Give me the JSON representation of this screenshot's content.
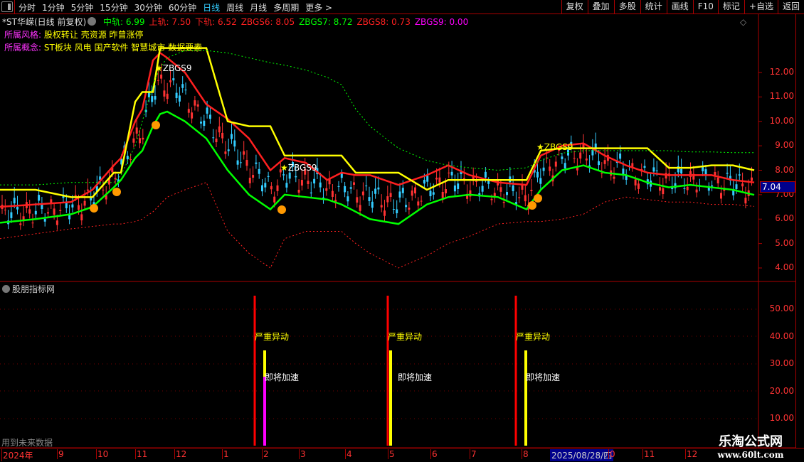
{
  "toolbar": {
    "periods": [
      "分时",
      "1分钟",
      "5分钟",
      "15分钟",
      "30分钟",
      "60分钟",
      "日线",
      "周线",
      "月线",
      "多周期",
      "更多 >"
    ],
    "active": "日线",
    "right_buttons": [
      "复权",
      "叠加",
      "多股",
      "统计",
      "画线",
      "F10",
      "标记",
      "+自选",
      "返回"
    ]
  },
  "stock": {
    "title": "*ST华嵘(日线 前复权)",
    "indicators": [
      {
        "label": "中轨:",
        "value": "6.99",
        "color": "#00ff00"
      },
      {
        "label": "上轨:",
        "value": "7.50",
        "color": "#ff2020"
      },
      {
        "label": "下轨:",
        "value": "6.52",
        "color": "#ff2020"
      },
      {
        "label": "ZBGS6:",
        "value": "8.05",
        "color": "#ff2020"
      },
      {
        "label": "ZBGS7:",
        "value": "8.72",
        "color": "#00ff00"
      },
      {
        "label": "ZBGS8:",
        "value": "0.73",
        "color": "#ff2020"
      },
      {
        "label": "ZBGS9:",
        "value": "0.00",
        "color": "#ff00ff"
      }
    ],
    "style_label": "所属风格:",
    "style_value": "股权转让 壳资源 昨曾涨停",
    "concept_label": "所属概念:",
    "concept_value": "ST板块 风电 国产软件 智慧城市 数据要素",
    "current_price": "7.04"
  },
  "price_axis": [
    "12.00",
    "11.00",
    "10.00",
    "9.00",
    "8.00",
    "7.00",
    "6.00",
    "5.00",
    "4.00"
  ],
  "zbgs9_label": "ZBGS9",
  "lower_panel": {
    "title": "股朋指标网",
    "axis": [
      "50.00",
      "40.00",
      "30.00",
      "20.00",
      "10.00"
    ],
    "signal1": "严重异动",
    "signal2": "即将加速",
    "future_note": "用到未来数据"
  },
  "time_axis": {
    "labels": [
      "2024年",
      "9",
      "10",
      "11",
      "12",
      "1",
      "2",
      "3",
      "4",
      "5",
      "6",
      "7",
      "8",
      "0",
      "11",
      "12"
    ],
    "cursor_date": "2025/08/28/四"
  },
  "watermark": {
    "title": "乐淘公式网",
    "url": "www.60lt.com"
  },
  "chart_data": {
    "type": "line",
    "ylim": [
      3.5,
      13.5
    ],
    "x": [
      0,
      50,
      100,
      130,
      160,
      170,
      190,
      200,
      215,
      225,
      235,
      260,
      290,
      320,
      350,
      380,
      400,
      430,
      460,
      480,
      500,
      520,
      560,
      600,
      630,
      660,
      700,
      740,
      760,
      790,
      820,
      850,
      880,
      910,
      940,
      970,
      1000,
      1030,
      1060
    ],
    "series": [
      {
        "name": "中轨",
        "color": "#00ff00",
        "values": [
          5.85,
          6.0,
          6.2,
          6.5,
          7.3,
          7.6,
          8.5,
          8.8,
          9.8,
          10.3,
          10.4,
          10.0,
          9.3,
          8.0,
          7.0,
          6.4,
          7.0,
          6.9,
          6.8,
          6.6,
          6.3,
          6.0,
          5.8,
          6.6,
          6.9,
          7.0,
          6.9,
          6.4,
          7.2,
          8.0,
          8.2,
          7.9,
          7.8,
          7.5,
          7.3,
          7.4,
          7.3,
          7.2,
          6.99
        ]
      },
      {
        "name": "上轨",
        "color": "#ff2020",
        "values": [
          6.5,
          6.6,
          6.7,
          7.2,
          8.2,
          8.5,
          10.0,
          10.5,
          12.5,
          12.8,
          12.6,
          12.0,
          10.7,
          10.1,
          9.3,
          8.0,
          8.5,
          8.3,
          7.6,
          7.9,
          7.8,
          7.8,
          7.4,
          7.8,
          8.2,
          7.8,
          7.5,
          7.4,
          8.6,
          9.0,
          9.1,
          8.6,
          8.2,
          7.9,
          7.8,
          7.8,
          7.8,
          7.6,
          7.5
        ]
      },
      {
        "name": "ZBGS6",
        "color": "#ffff00",
        "values": [
          7.2,
          7.2,
          6.9,
          6.9,
          7.9,
          7.9,
          10.8,
          11.2,
          11.2,
          13.0,
          13.0,
          13.0,
          13.0,
          10.0,
          9.8,
          9.8,
          8.6,
          8.6,
          8.6,
          8.6,
          7.9,
          7.9,
          7.9,
          7.2,
          7.6,
          7.6,
          7.6,
          7.6,
          8.8,
          8.9,
          8.9,
          8.9,
          8.9,
          8.9,
          8.1,
          8.1,
          8.2,
          8.2,
          8.0
        ]
      },
      {
        "name": "下轨",
        "color": "#ff2020",
        "dashed": true,
        "values": [
          5.2,
          5.4,
          5.6,
          5.7,
          5.8,
          5.8,
          5.9,
          6.0,
          6.3,
          6.6,
          6.9,
          7.2,
          7.5,
          5.5,
          4.6,
          4.0,
          5.2,
          5.5,
          5.5,
          5.5,
          5.0,
          4.6,
          4.0,
          4.5,
          5.0,
          5.3,
          5.8,
          5.9,
          5.9,
          6.0,
          6.2,
          6.7,
          6.9,
          6.8,
          6.7,
          6.7,
          6.6,
          6.6,
          6.52
        ]
      },
      {
        "name": "ZBGS7",
        "color": "#00ff00",
        "dashed": true,
        "values": [
          7.4,
          7.4,
          7.5,
          7.5,
          7.5,
          7.8,
          9.0,
          10.0,
          11.5,
          12.2,
          12.6,
          12.9,
          12.9,
          12.8,
          12.6,
          12.4,
          12.3,
          12.1,
          11.8,
          11.5,
          10.5,
          9.8,
          8.9,
          8.4,
          8.2,
          8.1,
          8.0,
          8.1,
          8.4,
          8.7,
          8.8,
          8.8,
          8.8,
          8.8,
          8.8,
          8.75,
          8.75,
          8.72,
          8.72
        ]
      }
    ]
  }
}
